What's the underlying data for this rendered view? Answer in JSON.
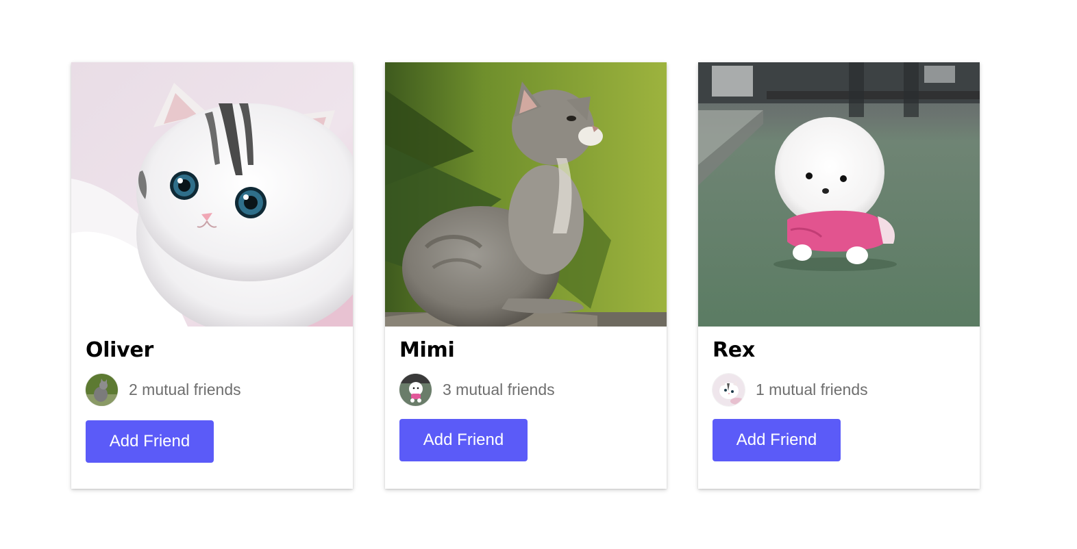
{
  "colors": {
    "accent": "#5b5bf8",
    "card_bg": "#ffffff",
    "muted_text": "#6e6e6e"
  },
  "cards": [
    {
      "name": "Oliver",
      "photo": "white-tabby-kitten-photo",
      "avatar": "grey-kitten-avatar",
      "mutual": "2 mutual friends",
      "button": "Add Friend"
    },
    {
      "name": "Mimi",
      "photo": "grey-kitten-photo",
      "avatar": "white-pomeranian-avatar",
      "mutual": "3 mutual friends",
      "button": "Add Friend"
    },
    {
      "name": "Rex",
      "photo": "white-pomeranian-photo",
      "avatar": "white-tabby-kitten-avatar",
      "mutual": "1 mutual friends",
      "button": "Add Friend"
    }
  ]
}
